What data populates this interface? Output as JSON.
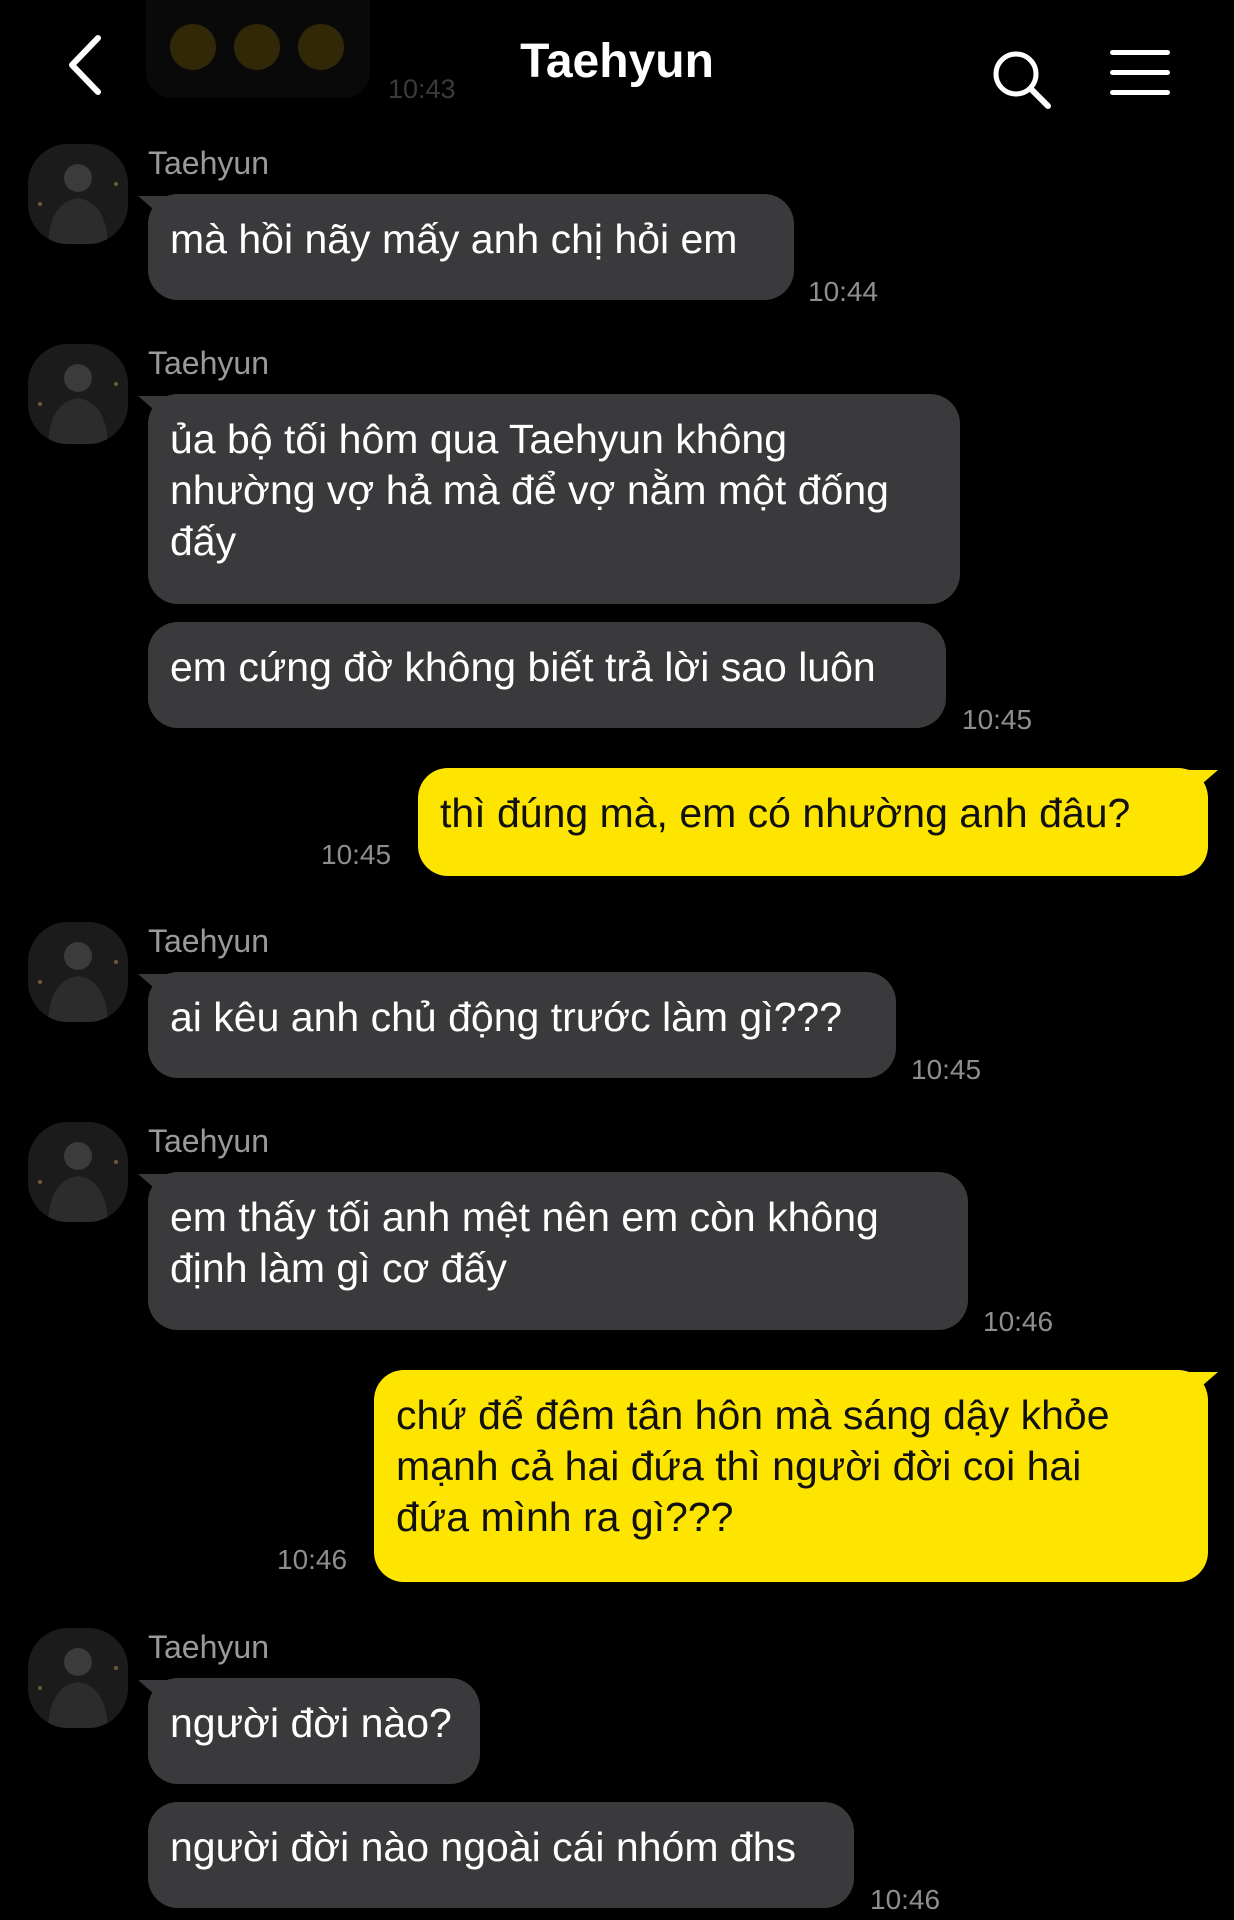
{
  "header": {
    "title": "Taehyun",
    "back_icon": "chevron-left-icon",
    "search_icon": "search-icon",
    "menu_icon": "hamburger-menu-icon"
  },
  "colors": {
    "background": "#000000",
    "incoming_bubble": "#3a3a3c",
    "outgoing_bubble": "#fee500",
    "timestamp": "#8e8e8e",
    "sender_name": "#9a9a9a"
  },
  "previous_message": {
    "content": "emoji",
    "time": "10:43"
  },
  "messages": [
    {
      "sender": "Taehyun",
      "direction": "incoming",
      "text": "mà hồi nãy mấy anh chị hỏi em",
      "time": "10:44"
    },
    {
      "sender": "Taehyun",
      "direction": "incoming",
      "text": "ủa bộ tối hôm qua Taehyun không\nnhường vợ hả mà để vợ nằm một đống\nđấy",
      "time": ""
    },
    {
      "sender": "Taehyun",
      "direction": "incoming",
      "text": "em cứng đờ không biết trả lời sao luôn",
      "time": "10:45"
    },
    {
      "sender": "me",
      "direction": "outgoing",
      "text": "thì đúng mà, em có nhường anh đâu?",
      "time": "10:45"
    },
    {
      "sender": "Taehyun",
      "direction": "incoming",
      "text": "ai kêu anh chủ động trước làm gì???",
      "time": "10:45"
    },
    {
      "sender": "Taehyun",
      "direction": "incoming",
      "text": "em thấy tối anh mệt nên em còn không\nđịnh làm gì cơ đấy",
      "time": "10:46"
    },
    {
      "sender": "me",
      "direction": "outgoing",
      "text": "chứ để đêm tân hôn mà sáng dậy khỏe\nmạnh cả hai đứa thì người đời coi hai\nđứa mình ra gì???",
      "time": "10:46"
    },
    {
      "sender": "Taehyun",
      "direction": "incoming",
      "text": "người đời nào?",
      "time": ""
    },
    {
      "sender": "Taehyun",
      "direction": "incoming",
      "text": "người đời nào ngoài cái nhóm đhs",
      "time": "10:46"
    }
  ]
}
